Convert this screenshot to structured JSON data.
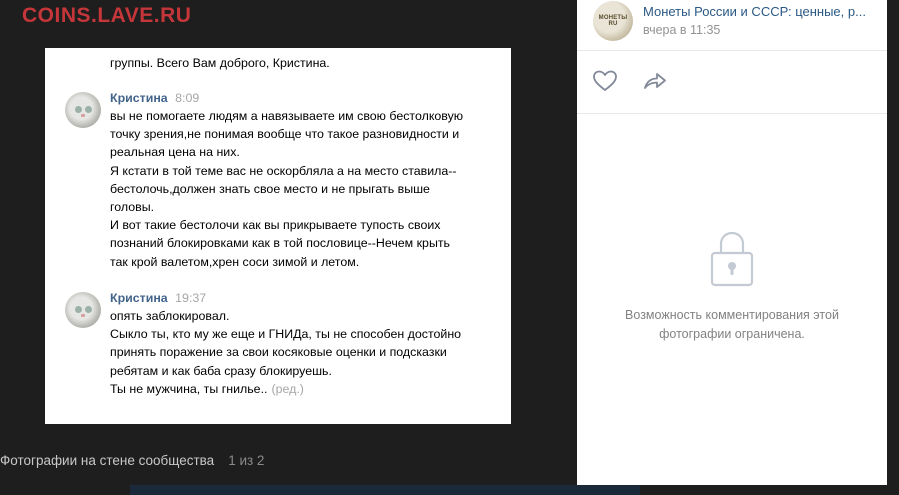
{
  "watermark": "COINS.LAVE.RU",
  "photo": {
    "intro_text": "группы. Всего Вам доброго, Кристина.",
    "messages": [
      {
        "author": "Кристина",
        "time": "8:09",
        "lines": [
          "вы не помогаете людям а навязываете им свою бестолковую",
          "точку зрения,не понимая вообще что такое разновидности и",
          "реальная цена на них.",
          "Я кстати в той теме вас не оскорбляла а на место ставила--",
          "бестолочь,должен знать свое место и не прыгать выше",
          "головы.",
          "И вот такие бестолочи как вы прикрываете тупость своих",
          "познаний блокировками как в той пословице--Нечем крыть",
          "так крой валетом,хрен соси зимой и летом."
        ]
      },
      {
        "author": "Кристина",
        "time": "19:37",
        "lines": [
          "опять заблокировал.",
          "Сыкло ты, кто му же еще и ГНИДа, ты не способен достойно",
          "принять поражение за свои косяковые оценки и подсказки",
          "ребятам и как баба сразу блокируешь.",
          "Ты не мужчина, ты гнилье.."
        ],
        "edited": "(ред.)"
      }
    ]
  },
  "caption": {
    "title": "Фотографии на стене сообщества",
    "counter": "1 из 2"
  },
  "panel": {
    "group_name": "Монеты России и СССР: ценные, р...",
    "group_avatar_text": "МОНЕТЫ RU",
    "post_date": "вчера в 11:35",
    "like_icon": "heart-icon",
    "share_icon": "share-arrow-icon",
    "lock_icon": "lock-icon",
    "restricted_line1": "Возможность комментирования этой",
    "restricted_line2": "фотографии ограничена."
  },
  "colors": {
    "background": "#1e1e1e",
    "watermark": "#c4363a",
    "author_link": "#42648b",
    "group_link": "#2a5885",
    "muted": "#939393",
    "icon": "#828a99"
  }
}
